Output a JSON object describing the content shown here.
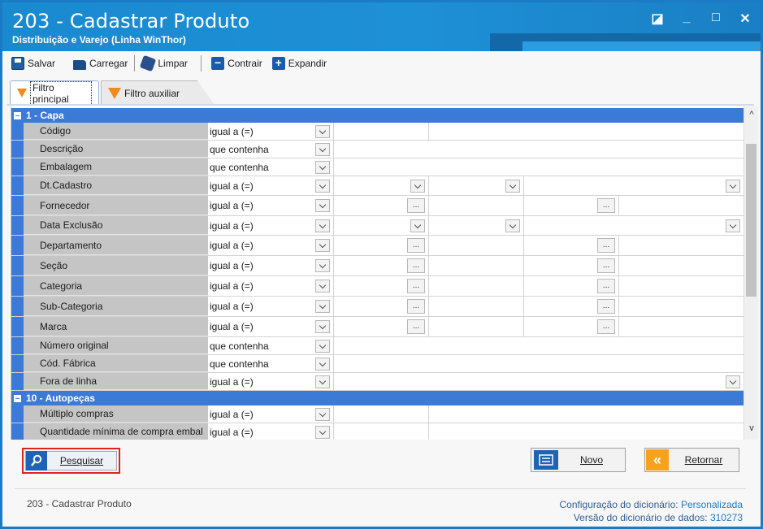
{
  "window": {
    "title": "203 - Cadastrar  Produto",
    "subtitle": "Distribuição e Varejo (Linha WinThor)",
    "controls": [
      "◪",
      "_",
      "□",
      "✕"
    ]
  },
  "toolbar": {
    "save": "Salvar",
    "load": "Carregar",
    "clean": "Limpar",
    "collapse": "Contrair",
    "expand": "Expandir"
  },
  "tabs": {
    "main": "Filtro principal",
    "aux": "Filtro auxiliar"
  },
  "groups": [
    {
      "title": "1 - Capa",
      "rows": [
        {
          "label": "Código",
          "op": "igual a (=)",
          "kind": "split"
        },
        {
          "label": "Descrição",
          "op": "que contenha",
          "kind": "text"
        },
        {
          "label": "Embalagem",
          "op": "que contenha",
          "kind": "text"
        },
        {
          "label": "Dt.Cadastro",
          "op": "igual a (=)",
          "kind": "dates"
        },
        {
          "label": "Fornecedor",
          "op": "igual a (=)",
          "kind": "lookup"
        },
        {
          "label": "Data Exclusão",
          "op": "igual a (=)",
          "kind": "dates"
        },
        {
          "label": "Departamento",
          "op": "igual a (=)",
          "kind": "lookup"
        },
        {
          "label": "Seção",
          "op": "igual a (=)",
          "kind": "lookup"
        },
        {
          "label": "Categoria",
          "op": "igual a (=)",
          "kind": "lookup"
        },
        {
          "label": "Sub-Categoria",
          "op": "igual a (=)",
          "kind": "lookup"
        },
        {
          "label": "Marca",
          "op": "igual a (=)",
          "kind": "lookup"
        },
        {
          "label": "Número original",
          "op": "que contenha",
          "kind": "text"
        },
        {
          "label": "Cód. Fábrica",
          "op": "que contenha",
          "kind": "text"
        },
        {
          "label": "Fora de linha",
          "op": "igual a (=)",
          "kind": "combo"
        }
      ]
    },
    {
      "title": "10 - Autopeças",
      "rows": [
        {
          "label": "Múltiplo compras",
          "op": "igual a (=)",
          "kind": "split"
        },
        {
          "label": "Quantidade mínima de compra embal",
          "op": "igual a (=)",
          "kind": "split"
        }
      ]
    }
  ],
  "buttons": {
    "search": "Pesquisar",
    "new": "Novo",
    "back": "Retornar",
    "lookup_glyph": "...",
    "back_glyph": "«"
  },
  "footer": {
    "screen": "203 - Cadastrar  Produto",
    "dict_config_label": "Configuração do dicionário:",
    "dict_config_value": "Personalizada",
    "dict_version_label": "Versão do dicionário de dados:",
    "dict_version_value": "310273"
  },
  "colors": {
    "titlebar": "#1a8ad0",
    "group_header": "#3b7ad6",
    "highlight_border": "#e0221f",
    "orange_accent": "#f7a21c"
  }
}
